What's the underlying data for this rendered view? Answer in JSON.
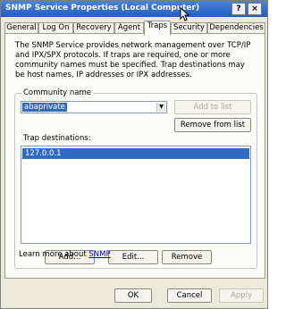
{
  "window": {
    "title": "SNMP Service Properties (Local Computer)",
    "help_glyph": "?",
    "close_glyph": "×"
  },
  "tabs": [
    {
      "label": "General"
    },
    {
      "label": "Log On"
    },
    {
      "label": "Recovery"
    },
    {
      "label": "Agent"
    },
    {
      "label": "Traps"
    },
    {
      "label": "Security"
    },
    {
      "label": "Dependencies"
    }
  ],
  "active_tab": "Traps",
  "description": "The SNMP Service provides network management over TCP/IP and IPX/SPX protocols. If traps are required, one or more community names must be specified. Trap destinations may be host names, IP addresses or IPX addresses.",
  "community": {
    "label": "Community name",
    "value": "abaprivate",
    "add_to_list": "Add to list",
    "remove_from_list": "Remove from list"
  },
  "trap_destinations": {
    "label": "Trap destinations:",
    "items": [
      "127.0.0.1"
    ],
    "add": "Add...",
    "edit": "Edit...",
    "remove": "Remove"
  },
  "learn_more": {
    "prefix": "Learn more about",
    "link": "SNMP"
  },
  "footer": {
    "ok": "OK",
    "cancel": "Cancel",
    "apply": "Apply"
  },
  "icons": {
    "combo_arrow": "dropdown-arrow-icon",
    "cursor": "mouse-pointer-icon"
  }
}
